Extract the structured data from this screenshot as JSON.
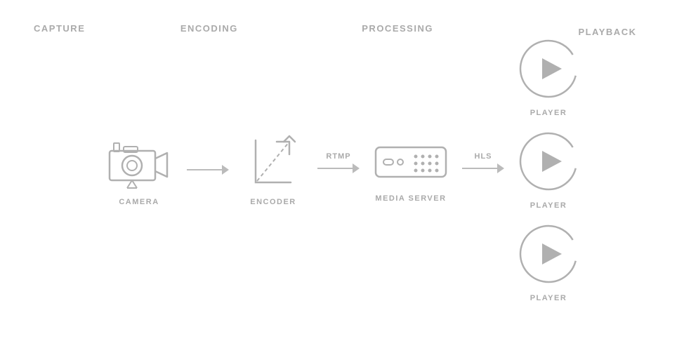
{
  "sections": {
    "capture": {
      "header": "CAPTURE",
      "component_label": "CAMERA"
    },
    "encoding": {
      "header": "ENCODING",
      "component_label": "ENCODER"
    },
    "processing": {
      "header": "PROCESSING",
      "component_label": "MEDIA SERVER"
    },
    "playback": {
      "header": "PLAYBACK",
      "component_label": "PLAYER"
    }
  },
  "arrows": {
    "rtmp_label": "RTMP",
    "hls_label": "HLS"
  },
  "colors": {
    "icon_stroke": "#b0b0b0",
    "label_color": "#b0b0b0",
    "header_color": "#aaaaaa"
  }
}
